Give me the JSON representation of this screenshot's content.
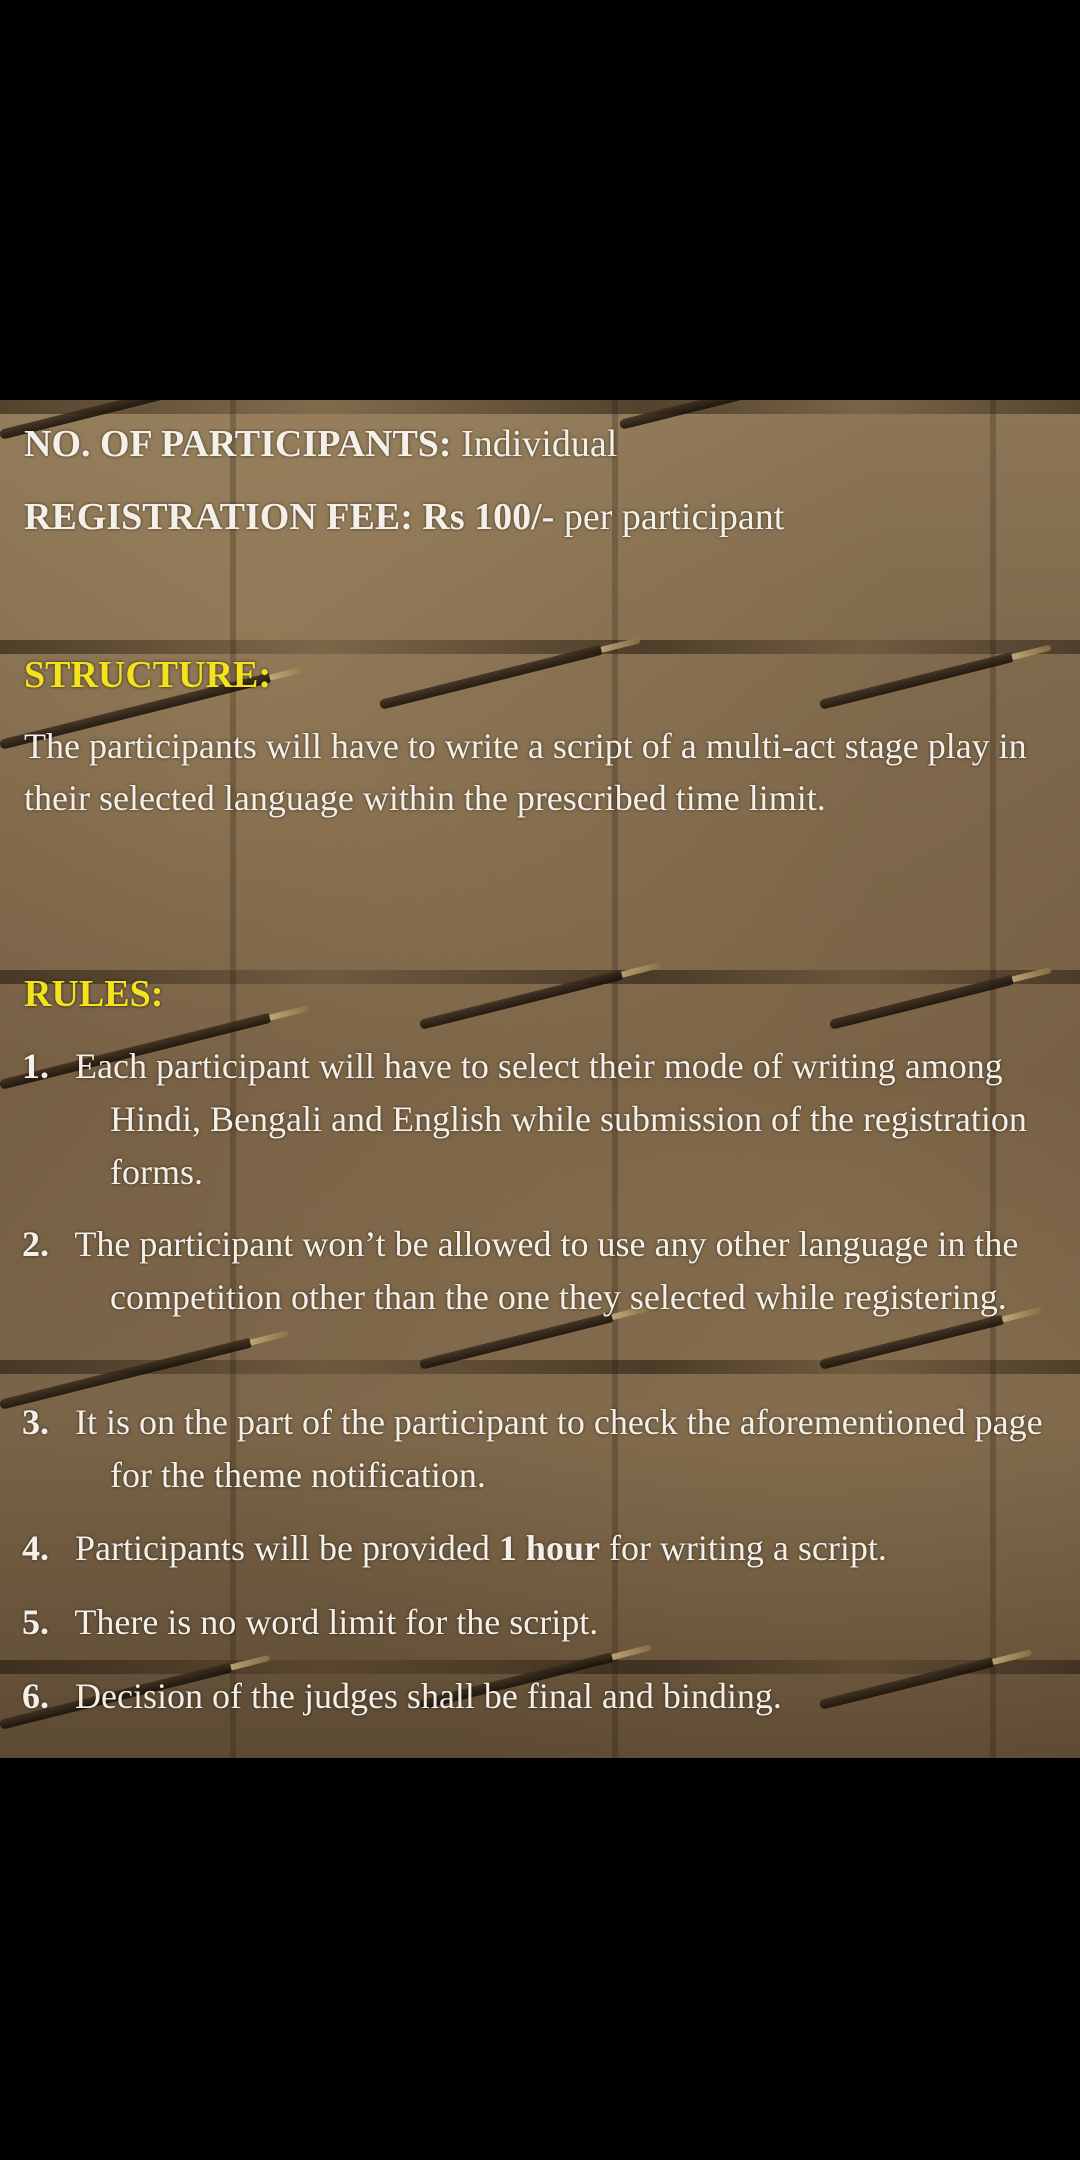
{
  "participants": {
    "label": "NO. OF PARTICIPANTS",
    "value": "Individual"
  },
  "registration": {
    "label": "REGISTRATION FEE",
    "amount": "Rs 100/-",
    "suffix": "per participant"
  },
  "structure": {
    "heading": "STRUCTURE:",
    "text": "The participants will have to write a script of a multi-act stage play in their selected language within the prescribed time limit."
  },
  "rules": {
    "heading": "RULES:",
    "items": [
      {
        "num": "1.",
        "text": "Each participant will have to select their mode of writing among Hindi, Bengali and English while submission of the registration forms."
      },
      {
        "num": "2.",
        "text": "The participant won’t be allowed to use any other language in the competition other than the one they selected while registering."
      },
      {
        "num": "3.",
        "text": "It is on the part of the participant to check the aforementioned page for the theme notification."
      },
      {
        "num": "4.",
        "text_before": "Participants will be provided",
        "bold": "1 hour",
        "text_after": "for writing a script."
      },
      {
        "num": "5.",
        "text": "There is no word limit for the script."
      },
      {
        "num": "6.",
        "text": "Decision of the judges shall be final and binding."
      }
    ]
  }
}
